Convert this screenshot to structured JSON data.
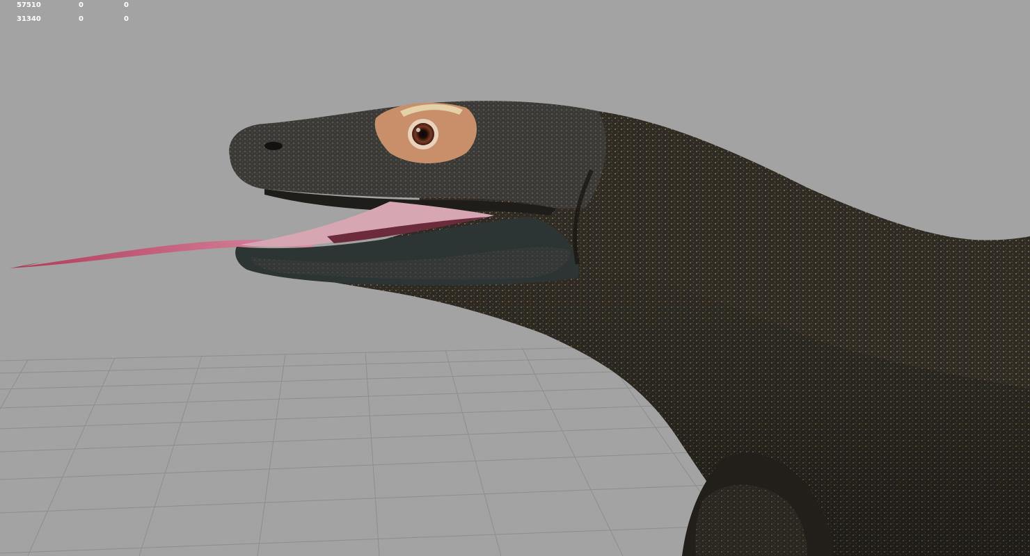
{
  "viewport": {
    "background_color": "#a3a3a3",
    "grid_color": "#8e8e8e"
  },
  "stats": {
    "rows": [
      [
        "57510",
        "0",
        "0"
      ],
      [
        "31340",
        "0",
        "0"
      ]
    ]
  },
  "model": {
    "skin_color": "#2f2b24",
    "speckle_color": "#8a7a55",
    "eye_patch_color": "#c8906a",
    "tongue_color": "#c8486a"
  }
}
